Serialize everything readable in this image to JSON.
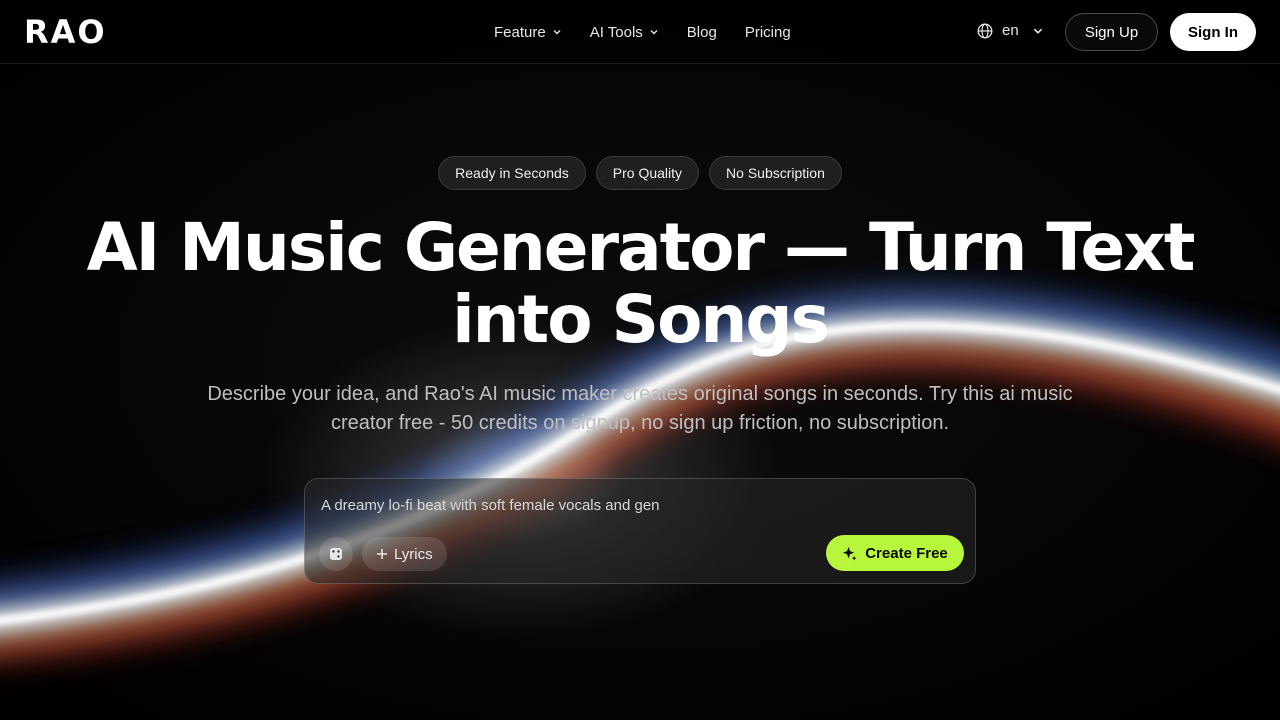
{
  "brand": {
    "logo_text": "RAO"
  },
  "nav": {
    "items": [
      {
        "label": "Feature",
        "has_dropdown": true
      },
      {
        "label": "AI Tools",
        "has_dropdown": true
      },
      {
        "label": "Blog",
        "has_dropdown": false
      },
      {
        "label": "Pricing",
        "has_dropdown": false
      }
    ],
    "language": {
      "label": "en",
      "icon": "globe-icon"
    },
    "sign_up": "Sign Up",
    "sign_in": "Sign In"
  },
  "hero": {
    "badges": [
      "Ready in Seconds",
      "Pro Quality",
      "No Subscription"
    ],
    "title": "AI Music Generator — Turn Text into Songs",
    "subtitle": "Describe your idea, and Rao's AI music maker creates original songs in seconds. Try this ai music creator free - 50 credits on signup, no sign up friction, no subscription."
  },
  "prompt": {
    "value": "A dreamy lo-fi beat with soft female vocals and gen",
    "dice_icon": "dice-icon",
    "lyrics_label": "Lyrics",
    "create_label": "Create Free",
    "create_icon": "sparkle-icon"
  },
  "colors": {
    "accent": "#b7f63a",
    "background": "#000000",
    "badge_bg": "#1f1f1f"
  }
}
